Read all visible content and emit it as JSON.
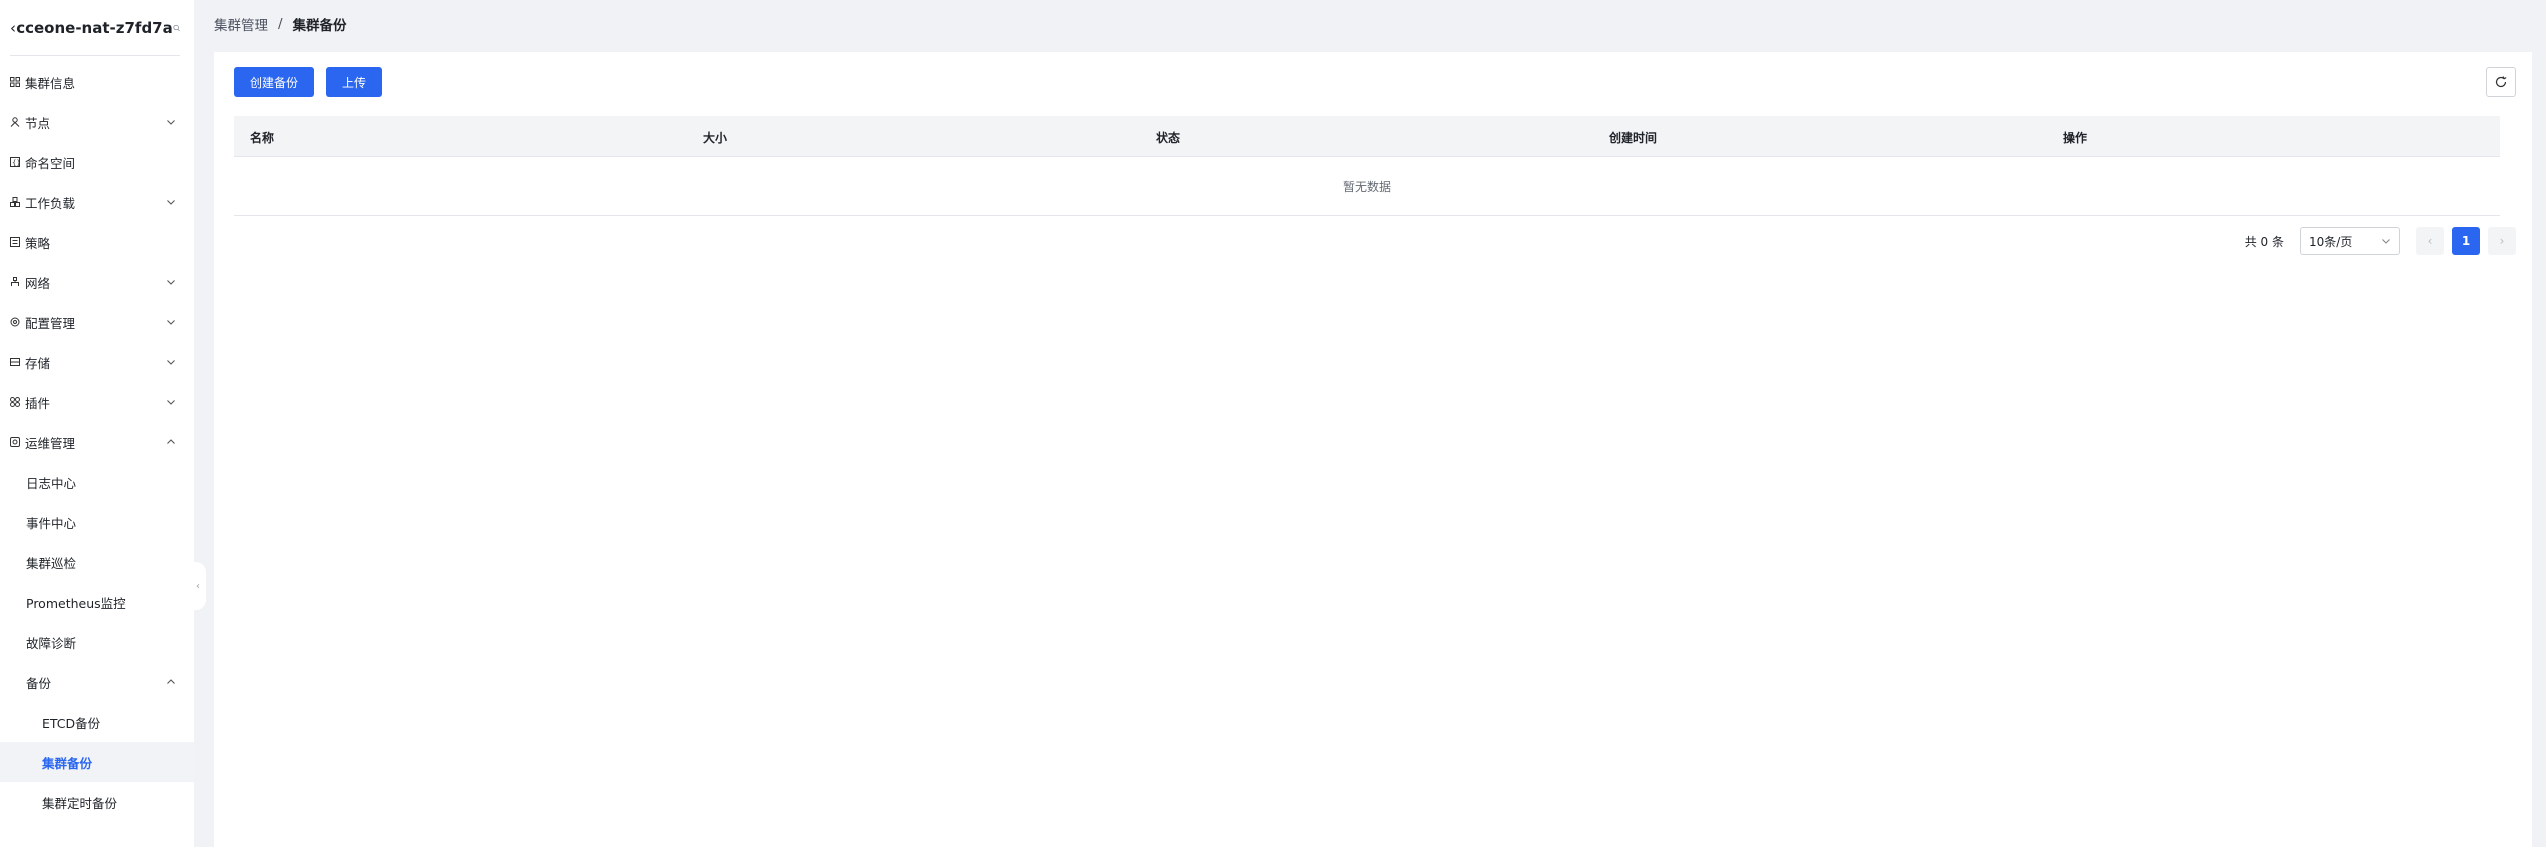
{
  "sidebar": {
    "cluster_name": "cceone-nat-z7fd7a",
    "items": [
      {
        "label": "集群信息",
        "icon": "grid-icon",
        "expandable": false
      },
      {
        "label": "节点",
        "icon": "node-icon",
        "expandable": true,
        "expanded": false
      },
      {
        "label": "命名空间",
        "icon": "namespace-icon",
        "expandable": false
      },
      {
        "label": "工作负载",
        "icon": "workload-icon",
        "expandable": true,
        "expanded": false
      },
      {
        "label": "策略",
        "icon": "policy-icon",
        "expandable": false
      },
      {
        "label": "网络",
        "icon": "network-icon",
        "expandable": true,
        "expanded": false
      },
      {
        "label": "配置管理",
        "icon": "config-icon",
        "expandable": true,
        "expanded": false
      },
      {
        "label": "存储",
        "icon": "storage-icon",
        "expandable": true,
        "expanded": false
      },
      {
        "label": "插件",
        "icon": "plugin-icon",
        "expandable": true,
        "expanded": false
      },
      {
        "label": "运维管理",
        "icon": "ops-icon",
        "expandable": true,
        "expanded": true
      }
    ],
    "ops_children": [
      "日志中心",
      "事件中心",
      "集群巡检",
      "Prometheus监控",
      "故障诊断"
    ],
    "backup_label": "备份",
    "backup_children": [
      "ETCD备份",
      "集群备份",
      "集群定时备份"
    ],
    "active_item": "集群备份"
  },
  "breadcrumb": {
    "parent": "集群管理",
    "separator": "/",
    "current": "集群备份"
  },
  "toolbar": {
    "create_label": "创建备份",
    "upload_label": "上传"
  },
  "table": {
    "columns": [
      "名称",
      "大小",
      "状态",
      "创建时间",
      "操作"
    ],
    "empty_text": "暂无数据"
  },
  "pagination": {
    "total_text": "共 0 条",
    "page_size": "10条/页",
    "current_page": "1"
  },
  "colors": {
    "primary": "#2b66f0",
    "sidebar_bg": "#ffffff",
    "page_bg": "#f1f2f5"
  }
}
